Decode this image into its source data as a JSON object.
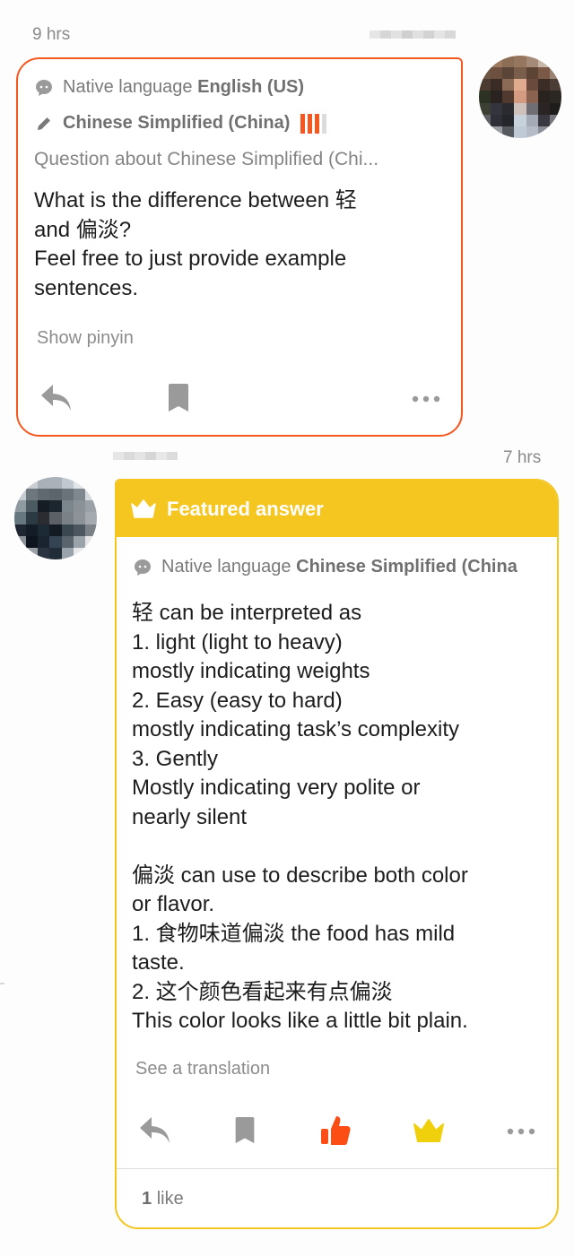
{
  "question": {
    "time": "9 hrs",
    "author_name_hidden": true,
    "native_language_label": "Native language",
    "native_language": "English (US)",
    "learning_language": "Chinese Simplified (China)",
    "learning_level": {
      "filled": 3,
      "total": 4
    },
    "topic": "Question about Chinese Simplified (Chi...",
    "body_lines": [
      "What is the difference between 轻",
      "and 偏淡?",
      "Feel free to just provide example",
      "sentences."
    ],
    "show_pinyin_label": "Show pinyin",
    "actions": [
      {
        "name": "reply",
        "icon": "reply-icon"
      },
      {
        "name": "bookmark",
        "icon": "bookmark-icon"
      },
      {
        "name": "more",
        "icon": "more-icon"
      }
    ]
  },
  "answer": {
    "time": "7 hrs",
    "author_name_hidden": true,
    "featured_label": "Featured answer",
    "native_language_label": "Native language",
    "native_language": "Chinese Simplified (China",
    "body_lines": [
      "轻 can be interpreted as",
      "1. light (light to heavy)",
      "mostly indicating weights",
      "2. Easy (easy to hard)",
      "mostly indicating task’s complexity",
      "3. Gently",
      "Mostly indicating very polite or",
      "nearly silent",
      "",
      "偏淡 can use to describe both color",
      "or flavor.",
      "1. 食物味道偏淡 the food has mild",
      "taste.",
      "2. 这个颜色看起来有点偏淡",
      "This color looks like a little bit plain."
    ],
    "see_translation_label": "See a translation",
    "actions": [
      {
        "name": "reply",
        "icon": "reply-icon"
      },
      {
        "name": "bookmark",
        "icon": "bookmark-icon"
      },
      {
        "name": "like",
        "icon": "thumbs-up-icon",
        "active": true
      },
      {
        "name": "feature",
        "icon": "crown-icon",
        "active": true
      },
      {
        "name": "more",
        "icon": "more-icon"
      }
    ],
    "likes_count": "1",
    "likes_label": "like"
  },
  "colors": {
    "question_accent": "#f4581f",
    "answer_accent": "#f5c520",
    "like_active": "#fb4d14",
    "crown_active": "#f0d00c",
    "icon_grey": "#9a9a9a"
  }
}
